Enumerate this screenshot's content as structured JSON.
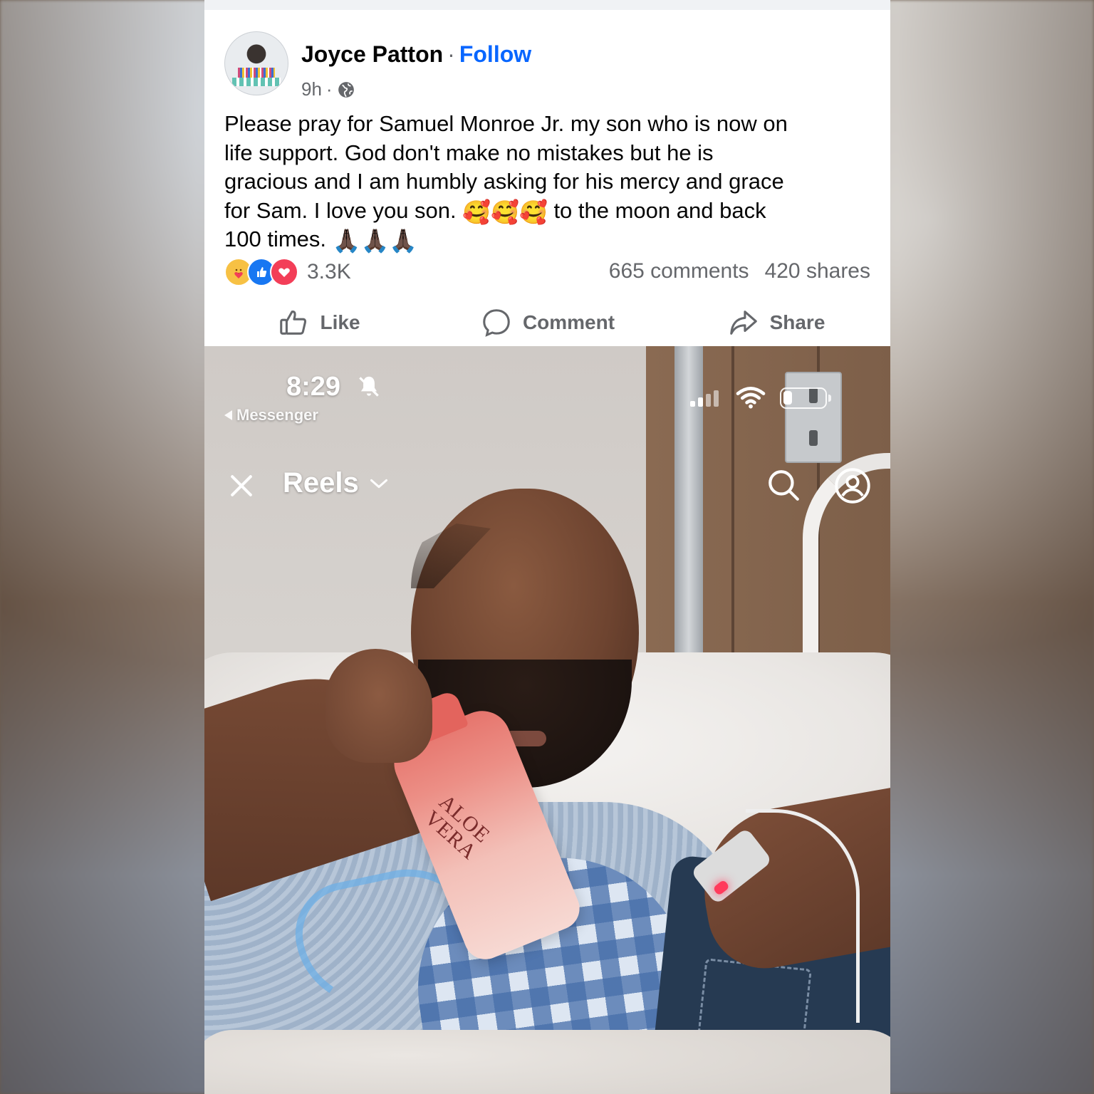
{
  "post": {
    "author": "Joyce Patton",
    "separator": "·",
    "follow_label": "Follow",
    "time_ago": "9h",
    "time_separator": "·",
    "audience_icon": "globe-icon",
    "text_line1": "Please pray for Samuel Monroe Jr. my son who is now on",
    "text_line2": "life support. God don't make no mistakes but he is",
    "text_line3": "gracious and I am humbly asking for his mercy and grace",
    "text_line4_a": "for Sam. I love you son.",
    "text_line4_emoji": "🥰🥰🥰",
    "text_line4_b": "to the moon and back",
    "text_line5_a": "100 times.",
    "text_line5_emoji": "🙏🏿🙏🏿🙏🏿",
    "reactions": [
      "care",
      "like",
      "love"
    ],
    "reaction_count": "3.3K",
    "comments": "665 comments",
    "shares": "420 shares",
    "actions": {
      "like": "Like",
      "comment": "Comment",
      "share": "Share"
    }
  },
  "embedded_screenshot": {
    "time": "8:29",
    "back_app": "Messenger",
    "title": "Reels",
    "bottle_label_line1": "ALOE",
    "bottle_label_line2": "VERA"
  },
  "colors": {
    "follow": "#0866ff",
    "secondary_text": "#65676b",
    "like_blue": "#1877f2",
    "love_red": "#f33e58",
    "care_yellow": "#f7c144"
  }
}
